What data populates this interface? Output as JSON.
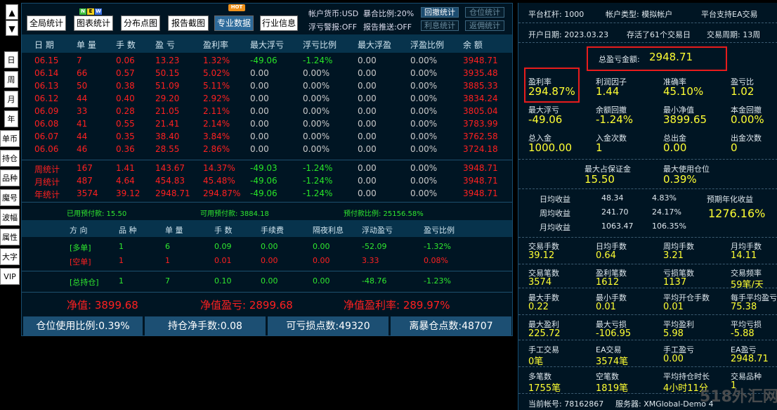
{
  "left_nav": {
    "up": "▲",
    "down": "▼",
    "items": [
      "日",
      "周",
      "月",
      "年",
      "单币",
      "持仓",
      "品种",
      "魔号",
      "波幅",
      "属性",
      "大字",
      "VIP"
    ]
  },
  "toolbar": {
    "buttons": [
      "全局统计",
      "图表统计",
      "分布点图",
      "报告截图",
      "专业数据",
      "行业信息"
    ],
    "new_badge": "NEW",
    "hot_badge": "HOT",
    "currency": "帐户货币:USD",
    "exposure": "暴合比例:20%",
    "float_warn": "浮亏警报:OFF",
    "report_push": "报告推送:OFF",
    "small_buttons": [
      "回撤统计",
      "仓位统计",
      "利息统计",
      "返佣统计"
    ]
  },
  "table": {
    "headers": [
      "日 期",
      "单 量",
      "手 数",
      "盈 亏",
      "盈利率",
      "最大浮亏",
      "浮亏比例",
      "最大浮盈",
      "浮盈比例",
      "余 额"
    ],
    "rows": [
      [
        "06.15",
        "7",
        "0.06",
        "13.23",
        "1.32%",
        "-49.06",
        "-1.24%",
        "0.00",
        "0.00%",
        "3948.71"
      ],
      [
        "06.14",
        "66",
        "0.57",
        "50.15",
        "5.02%",
        "0.00",
        "0.00%",
        "0.00",
        "0.00%",
        "3935.48"
      ],
      [
        "06.13",
        "50",
        "0.38",
        "51.09",
        "5.11%",
        "0.00",
        "0.00%",
        "0.00",
        "0.00%",
        "3885.33"
      ],
      [
        "06.12",
        "44",
        "0.40",
        "29.20",
        "2.92%",
        "0.00",
        "0.00%",
        "0.00",
        "0.00%",
        "3834.24"
      ],
      [
        "06.09",
        "33",
        "0.28",
        "21.05",
        "2.11%",
        "0.00",
        "0.00%",
        "0.00",
        "0.00%",
        "3805.04"
      ],
      [
        "06.08",
        "41",
        "0.55",
        "21.41",
        "2.14%",
        "0.00",
        "0.00%",
        "0.00",
        "0.00%",
        "3783.99"
      ],
      [
        "06.07",
        "44",
        "0.35",
        "38.40",
        "3.84%",
        "0.00",
        "0.00%",
        "0.00",
        "0.00%",
        "3762.58"
      ],
      [
        "06.06",
        "46",
        "0.36",
        "28.55",
        "2.86%",
        "0.00",
        "0.00%",
        "0.00",
        "0.00%",
        "3724.18"
      ]
    ],
    "summary": [
      [
        "周统计",
        "167",
        "1.41",
        "143.67",
        "14.37%",
        "-49.03",
        "-1.24%",
        "0.00",
        "0.00%",
        "3948.71"
      ],
      [
        "月统计",
        "487",
        "4.64",
        "454.83",
        "45.48%",
        "-49.06",
        "-1.24%",
        "0.00",
        "0.00%",
        "3948.71"
      ],
      [
        "年统计",
        "3574",
        "39.12",
        "2948.71",
        "294.87%",
        "-49.06",
        "-1.24%",
        "0.00",
        "0.00%",
        "3948.71"
      ]
    ]
  },
  "margin": {
    "used": "已用预付款: 15.50",
    "available": "可用预付款: 3884.18",
    "ratio": "预付款比例: 25156.58%"
  },
  "positions": {
    "headers": [
      "方 向",
      "品 种",
      "单 量",
      "手 数",
      "手续费",
      "隔夜利息",
      "浮动盈亏",
      "盈亏比例"
    ],
    "rows": [
      [
        "[多单]",
        "1",
        "6",
        "0.09",
        "0.00",
        "0.00",
        "-52.09",
        "-1.32%"
      ],
      [
        "[空单]",
        "1",
        "1",
        "0.01",
        "0.00",
        "0.00",
        "3.33",
        "0.08%"
      ]
    ],
    "total": [
      "[总持仓]",
      "1",
      "7",
      "0.10",
      "0.00",
      "0.00",
      "-48.76",
      "-1.23%"
    ]
  },
  "equity": {
    "net": "净值: 3899.68",
    "net_pl": "净值盈亏: 2899.68",
    "net_rate": "净值盈利率: 289.97%"
  },
  "bottom": [
    "仓位使用比例:0.39%",
    "持仓净手数:0.08",
    "可亏损点数:49320",
    "离暴仓点数:48707"
  ],
  "right": {
    "leverage": "平台杠杆: 1000",
    "acct_type": "帐户类型: 模拟帐户",
    "ea": "平台支持EA交易",
    "open_date": "开户日期: 2023.03.23",
    "survived": "存活了61个交易日",
    "period": "交易周期: 13周",
    "total_pl_label": "总盈亏金额:",
    "total_pl": "2948.71",
    "grid1": [
      {
        "l": "盈利率",
        "v": "294.87%"
      },
      {
        "l": "利润因子",
        "v": "1.44"
      },
      {
        "l": "准确率",
        "v": "45.10%"
      },
      {
        "l": "盈亏比",
        "v": "1.02"
      },
      {
        "l": "最大浮亏",
        "v": "-49.06"
      },
      {
        "l": "余额回撤",
        "v": "-1.24%"
      },
      {
        "l": "最小净值",
        "v": "3899.65"
      },
      {
        "l": "本金回撤",
        "v": "0.00%"
      },
      {
        "l": "总入金",
        "v": "1000.00"
      },
      {
        "l": "入金次数",
        "v": "1"
      },
      {
        "l": "总出金",
        "v": "0.00"
      },
      {
        "l": "出金次数",
        "v": "0"
      }
    ],
    "margin_max_label": "最大占保证金",
    "margin_max": "15.50",
    "pos_max_label": "最大使用仓位",
    "pos_max": "0.39%",
    "daily": [
      [
        "日均收益",
        "48.34",
        "4.83%"
      ],
      [
        "周均收益",
        "241.70",
        "24.17%"
      ],
      [
        "月均收益",
        "1063.47",
        "106.35%"
      ]
    ],
    "annual_label": "预期年化收益",
    "annual": "1276.16%",
    "grid2": [
      {
        "l": "交易手数",
        "v": "39.12"
      },
      {
        "l": "日均手数",
        "v": "0.64"
      },
      {
        "l": "周均手数",
        "v": "3.21"
      },
      {
        "l": "月均手数",
        "v": "14.11"
      },
      {
        "l": "交易笔数",
        "v": "3574"
      },
      {
        "l": "盈利笔数",
        "v": "1612"
      },
      {
        "l": "亏损笔数",
        "v": "1137"
      },
      {
        "l": "交易频率",
        "v": "59笔/天"
      },
      {
        "l": "最大手数",
        "v": "0.22"
      },
      {
        "l": "最小手数",
        "v": "0.01"
      },
      {
        "l": "平均开仓手数",
        "v": "0.01"
      },
      {
        "l": "每手平均盈亏",
        "v": "75.38"
      },
      {
        "l": "最大盈利",
        "v": "225.72"
      },
      {
        "l": "最大亏损",
        "v": "-106.95"
      },
      {
        "l": "平均盈利",
        "v": "5.98"
      },
      {
        "l": "平均亏损",
        "v": "-5.88"
      },
      {
        "l": "手工交易",
        "v": "0笔"
      },
      {
        "l": "EA交易",
        "v": "3574笔"
      },
      {
        "l": "手工盈亏",
        "v": "0.00"
      },
      {
        "l": "EA盈亏",
        "v": "2948.71"
      },
      {
        "l": "多笔数",
        "v": "1755笔"
      },
      {
        "l": "空笔数",
        "v": "1819笔"
      },
      {
        "l": "平均持仓时长",
        "v": "4小时11分"
      },
      {
        "l": "交易品种",
        "v": "1"
      }
    ],
    "account": "当前帐号: 78162867",
    "server": "服务器: XMGlobal-Demo 4"
  },
  "watermark": "518外汇网"
}
